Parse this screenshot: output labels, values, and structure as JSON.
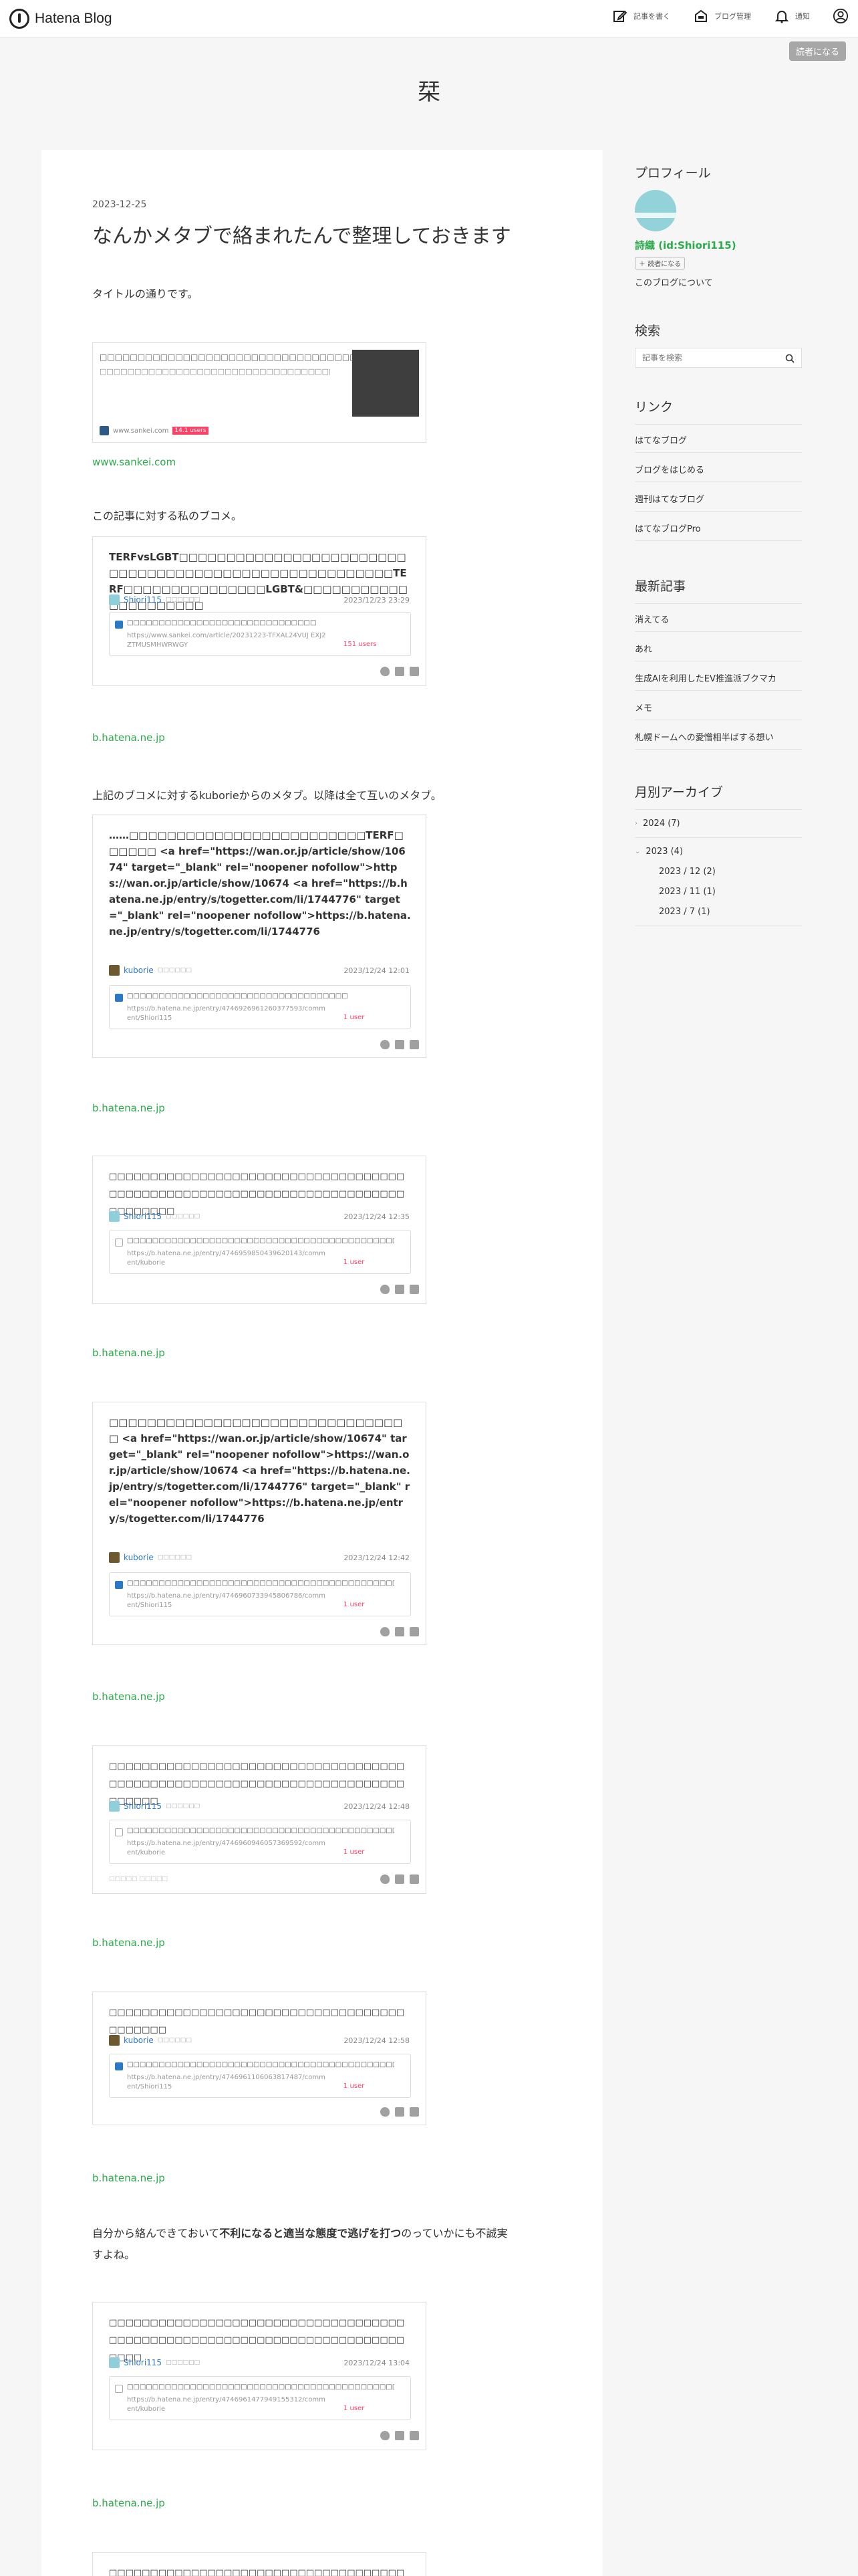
{
  "header": {
    "logo_text": "Hatena Blog",
    "nav": [
      {
        "label": "記事を書く",
        "icon": "pencil-icon"
      },
      {
        "label": "ブログ管理",
        "icon": "blog-manage-icon"
      },
      {
        "label": "通知",
        "icon": "bell-icon"
      },
      {
        "label": "",
        "icon": "user-icon"
      }
    ],
    "subscribe_label": "読者になる"
  },
  "blog": {
    "title": "栞"
  },
  "post": {
    "date": "2023-12-25",
    "title": "なんかメタブで絡まれたんで整理しておきます",
    "intro": "タイトルの通りです。",
    "embed": {
      "title": "□□□□□□□□□□□□□□□□□□□□□□□□□□□□□□□□□□",
      "desc": "□□□□□□□□□□□□□□□□□□□□□□□□□□□□□□□□□□□□□□□□□□□□□□□□□□□□□□□□...",
      "site": "www.sankei.com",
      "users": "14.1 users"
    },
    "link_sankei": "www.sankei.com",
    "para_bookmark": "この記事に対する私のブコメ。",
    "para_meta": "上記のブコメに対するkuborieからのメタブ。以降は全て互いのメタブ。",
    "para_conclusion_1": "自分から絡んできておいて",
    "para_conclusion_bold": "不利になると適当な態度で逃げを打つ",
    "para_conclusion_2": "のっていかにも不誠実",
    "para_conclusion_3": "すよね。",
    "cards": [
      {
        "text": "TERFvsLGBT□□□□□□□□□□□□□□□□□□□□□□□□□□□□□□□□□□□□□□□□□□□□□□□□□□□□□□TERF□□□□□□□□□□□□□□□LGBT&□□□□□□□□□□□□□□□□□□□□□",
        "user": "Shiori115",
        "user_sub": "□□□□□□",
        "time": "2023/12/23 23:29",
        "inner_title": "□□□□□□□□□□□□□□□□□□□□□□□□□□□□□□",
        "inner_url": "https://www.sankei.com/article/20231223-TFXAL24VUJ EXJ2ZTMUSMHWRWGY",
        "inner_users": "151 users",
        "link": "b.hatena.ne.jp"
      },
      {
        "text": "……□□□□□□□□□□□□□□□□□□□□□□□□□TERF□□□□□□ <a href=\"https://wan.or.jp/article/show/10674\" target=\"_blank\" rel=\"noopener nofollow\">https://wan.or.jp/article/show/10674 <a href=\"https://b.hatena.ne.jp/entry/s/togetter.com/li/1744776\" target=\"_blank\" rel=\"noopener nofollow\">https://b.hatena.ne.jp/entry/s/togetter.com/li/1744776",
        "user": "kuborie",
        "user_sub": "□□□□□□",
        "time": "2023/12/24 12:01",
        "inner_title": "□□□□□□□□□□□□□□□□□□□□□□□□□□□□□□□□□□□",
        "inner_url": "https://b.hatena.ne.jp/entry/4746926961260377593/comment/Shiori115",
        "inner_users": "1 user",
        "link": "b.hatena.ne.jp"
      },
      {
        "text": "□□□□□□□□□□□□□□□□□□□□□□□□□□□□□□□□□□□□□□□□□□□□□□□□□□□□□□□□□□□□□□□□□□□□□□□□□□□□□□□□",
        "user": "Shiori115",
        "user_sub": "□□□□□□",
        "time": "2023/12/24 12:35",
        "inner_title": "□□□□□□□□□□□□□□□□□□□□□□□□□□□□□□□□□□□□□□□□□□□□□",
        "inner_url": "https://b.hatena.ne.jp/entry/4746959850439620143/comment/kuborie",
        "inner_users": "1 user",
        "link": "b.hatena.ne.jp"
      },
      {
        "text": "□□□□□□□□□□□□□□□□□□□□□□□□□□□□□□□□ <a href=\"https://wan.or.jp/article/show/10674\" target=\"_blank\" rel=\"noopener nofollow\">https://wan.or.jp/article/show/10674 <a href=\"https://b.hatena.ne.jp/entry/s/togetter.com/li/1744776\" target=\"_blank\" rel=\"noopener nofollow\">https://b.hatena.ne.jp/entry/s/togetter.com/li/1744776",
        "user": "kuborie",
        "user_sub": "□□□□□□",
        "time": "2023/12/24 12:42",
        "inner_title": "□□□□□□□□□□□□□□□□□□□□□□□□□□□□□□□□□□□□□□□□□□□□□□□□□□",
        "inner_url": "https://b.hatena.ne.jp/entry/4746960733945806786/comment/Shiori115",
        "inner_users": "1 user",
        "link": "b.hatena.ne.jp"
      },
      {
        "text": "□□□□□□□□□□□□□□□□□□□□□□□□□□□□□□□□□□□□□□□□□□□□□□□□□□□□□□□□□□□□□□□□□□□□□□□□□□□□□□",
        "user": "Shiori115",
        "user_sub": "□□□□□□",
        "time": "2023/12/24 12:48",
        "inner_title": "□□□□□□□□□□□□□□□□□□□□□□□□□□□□□□□□□□□□□□□□□□□□□□□□□□□□",
        "inner_url": "https://b.hatena.ne.jp/entry/4746960946057369592/comment/kuborie",
        "inner_users": "1 user",
        "edit_hint": "□□□□□ □□□□□",
        "link": "b.hatena.ne.jp"
      },
      {
        "text": "□□□□□□□□□□□□□□□□□□□□□□□□□□□□□□□□□□□□□□□□□□□",
        "user": "kuborie",
        "user_sub": "□□□□□□",
        "time": "2023/12/24 12:58",
        "inner_title": "□□□□□□□□□□□□□□□□□□□□□□□□□□□□□□□□□□□□□□□□□□□□□□□□□□□□□□□□□□□□",
        "inner_url": "https://b.hatena.ne.jp/entry/4746961106063817487/comment/Shiori115",
        "inner_users": "1 user",
        "link": "b.hatena.ne.jp"
      },
      {
        "text": "□□□□□□□□□□□□□□□□□□□□□□□□□□□□□□□□□□□□□□□□□□□□□□□□□□□□□□□□□□□□□□□□□□□□□□□□□□□□",
        "user": "Shiori115",
        "user_sub": "□□□□□□",
        "time": "2023/12/24 13:04",
        "inner_title": "□□□□□□□□□□□□□□□□□□□□□□□□□□□□□□□□□□□□□□□□□□□□□□□□□□□□□□□□□□□□□□",
        "inner_url": "https://b.hatena.ne.jp/entry/4746961477949155312/comment/kuborie",
        "inner_users": "1 user",
        "link": "b.hatena.ne.jp"
      },
      {
        "text": "□□□□□□□□□□□□□□□□□□□□□□□□□□□□□□□□□□□□□□□□□□□□□□□□□□□□□□□□□□□□□"
      }
    ]
  },
  "sidebar": {
    "profile_heading": "プロフィール",
    "profile_name": "詩織 (id:Shiori115)",
    "reader_button": "読者になる",
    "about_link": "このブログについて",
    "search_heading": "検索",
    "search_placeholder": "記事を検索",
    "links_heading": "リンク",
    "links": [
      "はてなブログ",
      "ブログをはじめる",
      "週刊はてなブログ",
      "はてなブログPro"
    ],
    "recent_heading": "最新記事",
    "recent": [
      "消えてる",
      "あれ",
      "生成AIを利用したEV推進派ブクマカ",
      "メモ",
      "札幌ドームへの愛憎相半ばする想い"
    ],
    "archive_heading": "月別アーカイブ",
    "archive_years": [
      {
        "label": "2024 (7)",
        "expanded": false
      },
      {
        "label": "2023 (4)",
        "expanded": true
      }
    ],
    "archive_months": [
      "2023 / 12 (2)",
      "2023 / 11 (1)",
      "2023 / 7 (1)"
    ]
  }
}
